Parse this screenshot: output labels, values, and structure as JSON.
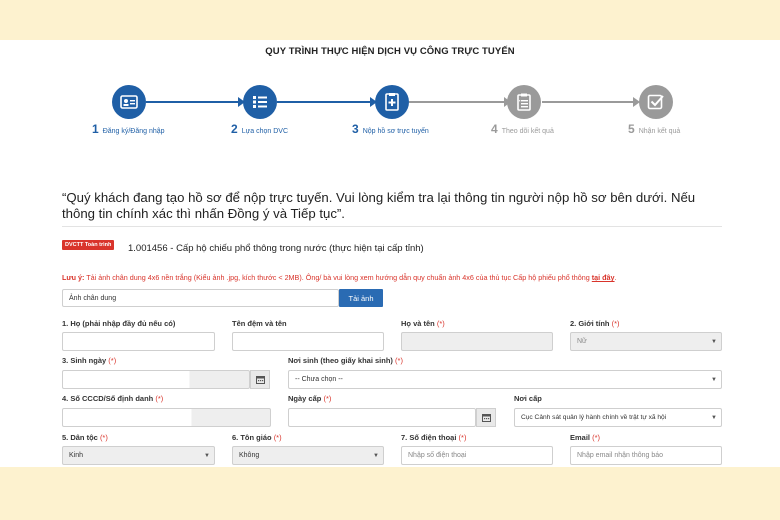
{
  "process_title": "QUY TRÌNH THỰC HIỆN DỊCH VỤ CÔNG TRỰC TUYẾN",
  "steps": [
    {
      "num": "1",
      "label": "Đăng ký/Đăng nhập",
      "icon": "id-card-icon",
      "status": "done"
    },
    {
      "num": "2",
      "label": "Lựa chọn DVC",
      "icon": "list-icon",
      "status": "done"
    },
    {
      "num": "3",
      "label": "Nộp hồ sơ trực tuyến",
      "icon": "document-plus-icon",
      "status": "done"
    },
    {
      "num": "4",
      "label": "Theo dõi kết quả",
      "icon": "clipboard-icon",
      "status": "todo"
    },
    {
      "num": "5",
      "label": "Nhận kết quả",
      "icon": "checkbox-icon",
      "status": "todo"
    }
  ],
  "notice_text": "“Quý khách đang tạo hồ sơ để nộp trực tuyến. Vui lòng kiểm tra lại thông tin người nộp hồ sơ bên dưới. Nếu thông tin chính xác thì nhấn Đồng ý và Tiếp tục”.",
  "service": {
    "badge": "DVCTT Toàn trình",
    "name": "1.001456 - Cấp hộ chiếu phổ thông trong nước (thực hiện tại cấp tỉnh)"
  },
  "note": {
    "prefix": "Lưu ý:",
    "text": " Tải ảnh chân dung 4x6 nền trắng (Kiểu ảnh .jpg, kích thước < 2MB). Ông/ bà vui lòng xem hướng dẫn quy chuẩn ảnh 4x6 của thủ tục Cấp hộ phiếu phổ thông ",
    "link": "tại đây",
    "suffix": "."
  },
  "photo": {
    "placeholder": "Ảnh chân dung",
    "upload_label": "Tải ảnh"
  },
  "form": {
    "ho": {
      "label": "1. Họ (phải nhập đầy đủ nếu có)",
      "value": ""
    },
    "ten_dem_va_ten": {
      "label": "Tên đệm và tên",
      "value": ""
    },
    "ho_va_ten": {
      "label": "Họ và tên",
      "req": "(*)",
      "value": ""
    },
    "gioi_tinh": {
      "label": "2. Giới tính",
      "req": "(*)",
      "value": "Nữ"
    },
    "sinh_ngay": {
      "label": "3. Sinh ngày",
      "req": "(*)",
      "value": ""
    },
    "noi_sinh": {
      "label": "Nơi sinh (theo giấy khai sinh)",
      "req": "(*)",
      "value": "-- Chưa chọn --"
    },
    "so_cccd": {
      "label": "4. Số CCCD/Số định danh",
      "req": "(*)",
      "value": ""
    },
    "ngay_cap": {
      "label": "Ngày cấp",
      "req": "(*)",
      "value": ""
    },
    "noi_cap": {
      "label": "Nơi cấp",
      "value": "Cục Cảnh sát quản lý hành chính về trật tự xã hội"
    },
    "dan_toc": {
      "label": "5. Dân tộc",
      "req": "(*)",
      "value": "Kinh"
    },
    "ton_giao": {
      "label": "6. Tôn giáo",
      "req": "(*)",
      "value": "Không"
    },
    "so_dien_thoai": {
      "label": "7. Số điện thoại",
      "req": "(*)",
      "placeholder": "Nhập số điện thoại"
    },
    "email": {
      "label": "Email",
      "req": "(*)",
      "placeholder": "Nhập email nhận thông báo"
    }
  },
  "colors": {
    "primary": "#1f5fa6",
    "inactive": "#9a9a9a",
    "required": "#d9342b",
    "background": "#fdf2cf"
  }
}
